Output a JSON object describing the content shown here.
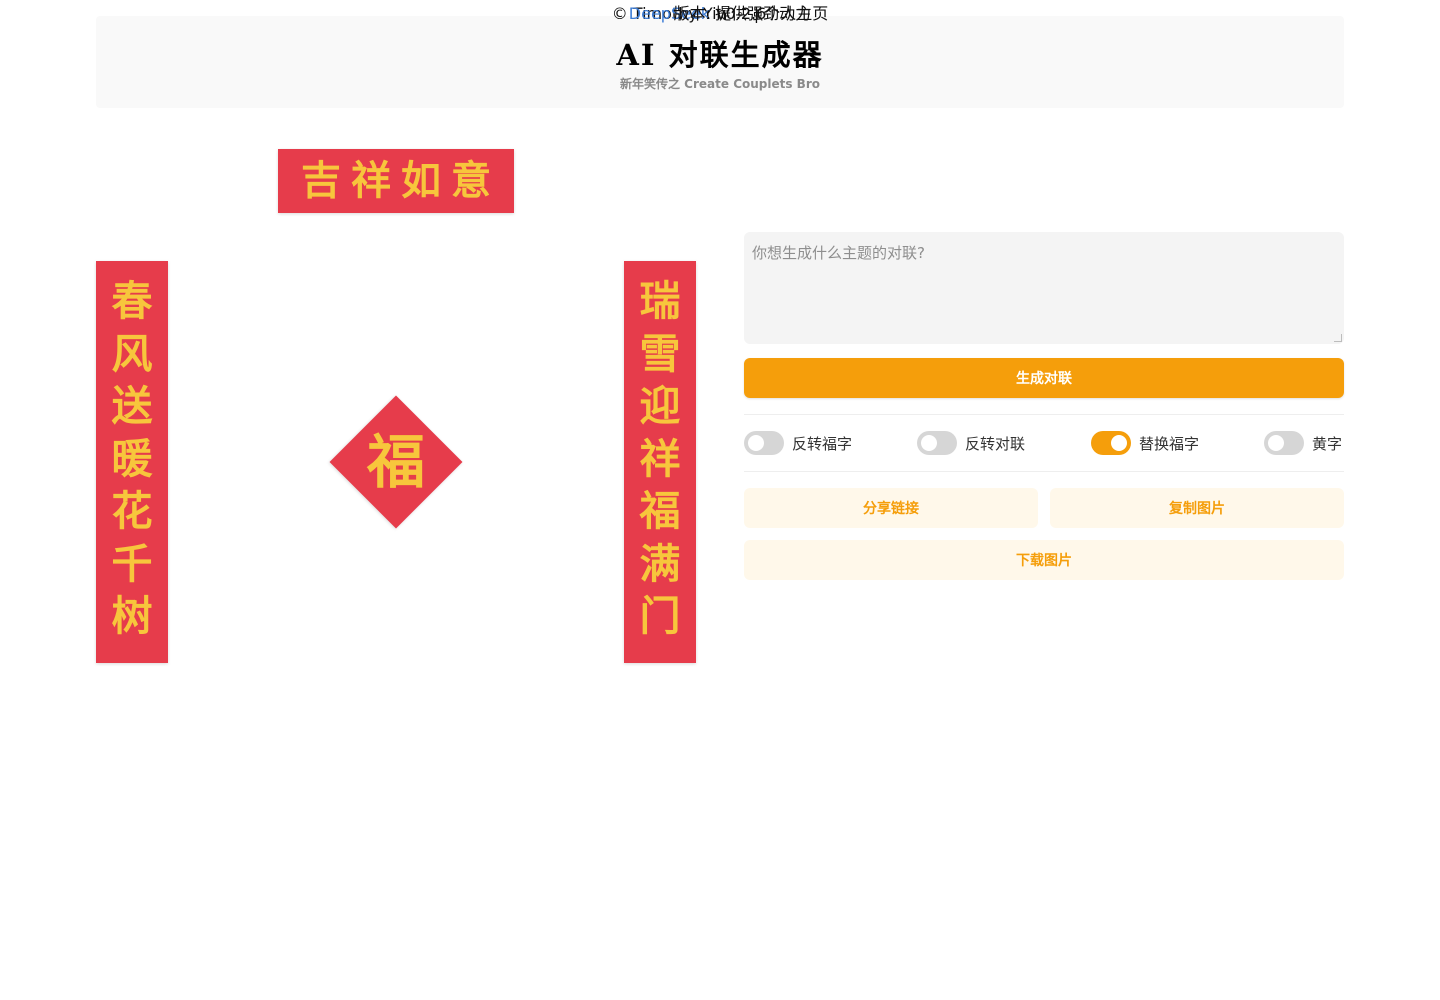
{
  "header": {
    "title": "AI 对联生成器",
    "subtitle": "新年笑传之 Create Couplets Bro"
  },
  "couplet": {
    "horizontal": "吉祥如意",
    "left": [
      "春",
      "风",
      "送",
      "暖",
      "花",
      "千",
      "树"
    ],
    "right": [
      "瑞",
      "雪",
      "迎",
      "祥",
      "福",
      "满",
      "门"
    ],
    "fu": "福",
    "colors": {
      "paper": "#e63c4b",
      "ink": "#f7c63c"
    }
  },
  "form": {
    "prompt_placeholder": "你想生成什么主题的对联?",
    "prompt_value": "",
    "generate_label": "生成对联"
  },
  "toggles": [
    {
      "label": "反转福字",
      "on": false
    },
    {
      "label": "反转对联",
      "on": false
    },
    {
      "label": "替换福字",
      "on": true
    },
    {
      "label": "黄字",
      "on": false
    }
  ],
  "actions": {
    "share_label": "分享链接",
    "copy_label": "复制图片",
    "download_label": "下载图片"
  },
  "footer": {
    "copyright": "© Timothy Yin",
    "github_icon": "github-icon",
    "separator": "|",
    "homepage_label": "个人主页",
    "powered_link": "DeepSeek",
    "powered_text": "提供强劲动力",
    "version": "版本: v0.2.6"
  },
  "theme": {
    "accent": "#f59e0b",
    "accent_soft": "#fff8ea"
  }
}
